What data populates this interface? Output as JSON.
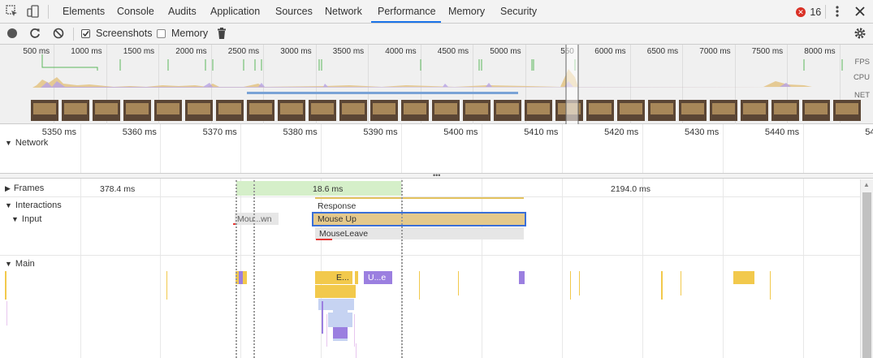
{
  "tabs": {
    "elements": "Elements",
    "console": "Console",
    "audits": "Audits",
    "application": "Application",
    "sources": "Sources",
    "network": "Network",
    "performance": "Performance",
    "memory": "Memory",
    "security": "Security"
  },
  "errors": {
    "count": "16"
  },
  "toolbar": {
    "screenshots": "Screenshots",
    "memory": "Memory",
    "screenshots_checked": true,
    "memory_checked": false
  },
  "overview": {
    "ticks": [
      "500 ms",
      "1000 ms",
      "1500 ms",
      "2000 ms",
      "2500 ms",
      "3000 ms",
      "3500 ms",
      "4000 ms",
      "4500 ms",
      "5000 ms",
      "550",
      "6000 ms",
      "6500 ms",
      "7000 ms",
      "7500 ms",
      "8000 ms"
    ],
    "tracks": {
      "fps": "FPS",
      "cpu": "CPU",
      "net": "NET"
    }
  },
  "details": {
    "ticks": [
      "5350 ms",
      "5360 ms",
      "5370 ms",
      "5380 ms",
      "5390 ms",
      "5400 ms",
      "5410 ms",
      "5420 ms",
      "5430 ms",
      "5440 ms",
      "545"
    ],
    "network": "Network",
    "frames": "Frames",
    "frame_times": {
      "a": "378.4 ms",
      "b": "18.6 ms",
      "c": "2194.0 ms"
    },
    "interactions": "Interactions",
    "input": "Input",
    "response": "Response",
    "mouse_down": "Mou...wn",
    "mouse_up": "Mouse Up",
    "mouse_leave": "MouseLeave",
    "main": "Main",
    "evt_e": "E...",
    "evt_u": "U...e"
  },
  "colors": {
    "accent": "#1a73e8",
    "scripting": "#f2c94c",
    "rendering": "#9b7fe0",
    "frames_green": "#d5efc9",
    "selected_border": "#3a6fd8"
  }
}
